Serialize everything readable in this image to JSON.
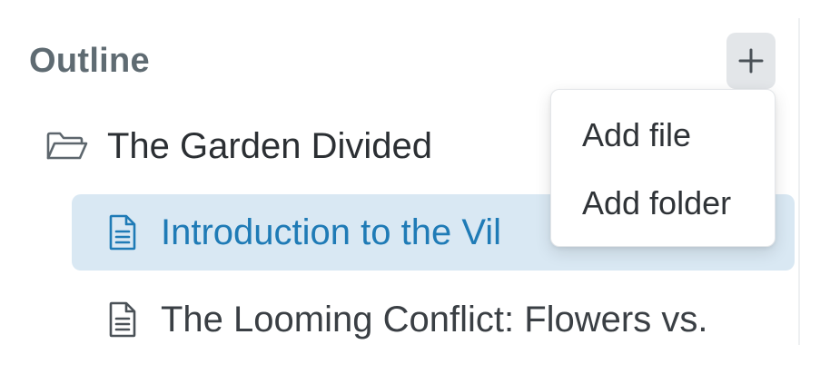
{
  "sidebar": {
    "title": "Outline",
    "add_button": {
      "icon": "plus-icon"
    },
    "tree": {
      "folder": {
        "label": "The Garden Divided",
        "icon": "folder-open-icon"
      },
      "files": [
        {
          "label": "Introduction to the Vil",
          "icon": "document-icon",
          "selected": true
        },
        {
          "label": "The Looming Conflict: Flowers vs.",
          "icon": "document-icon",
          "selected": false
        }
      ]
    }
  },
  "add_menu": {
    "items": [
      {
        "label": "Add file"
      },
      {
        "label": "Add folder"
      }
    ]
  },
  "colors": {
    "selected_bg": "#d9e8f3",
    "selected_text": "#1f7bb6",
    "title_text": "#5f6b72",
    "button_bg": "#e3e6e9"
  }
}
